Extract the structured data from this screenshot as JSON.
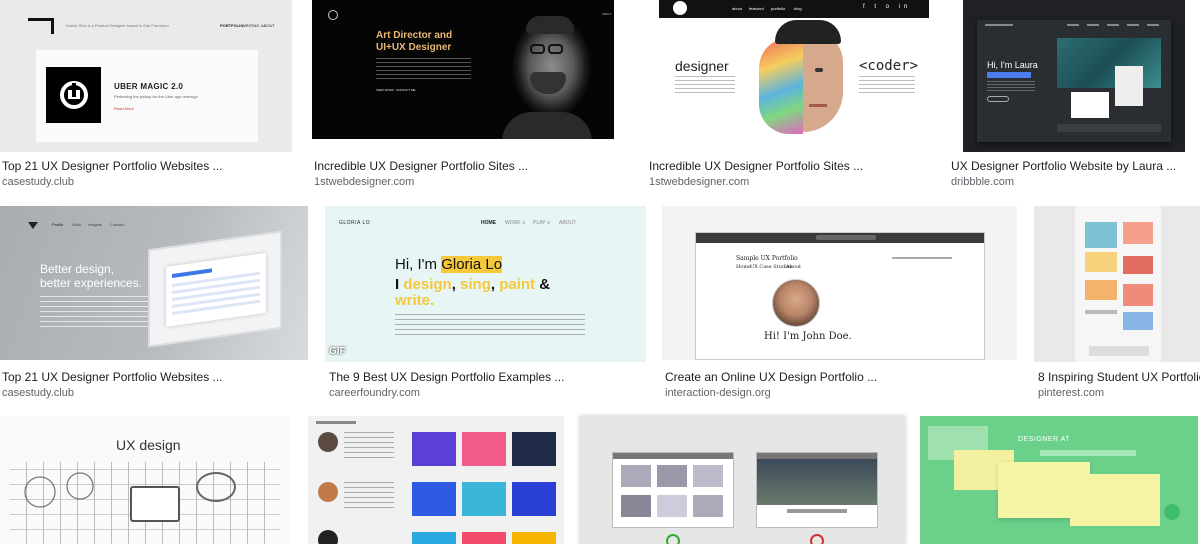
{
  "results": [
    {
      "title": "Top 21 UX Designer Portfolio Websites ...",
      "source": "casestudy.club",
      "thumb": {
        "nav": [
          "PORTFOLIO",
          "WRITING",
          "ABOUT"
        ],
        "tagline": "Karish Reis is a Product Designer based in San Francisco",
        "card_title": "UBER MAGIC 2.0",
        "card_desc": "Perfecting the pickup for the Uber app redesign",
        "card_link": "Read More"
      }
    },
    {
      "title": "Incredible UX Designer Portfolio Sites ...",
      "source": "1stwebdesigner.com",
      "thumb": {
        "heading_1": "Art Director and",
        "heading_2": "UI+UX Designer",
        "nav": [
          "HOME",
          "PORTFOLIO",
          "CONTACT"
        ],
        "cta": [
          "VIEW WORK",
          "CONTACT ME"
        ]
      }
    },
    {
      "title": "Incredible UX Designer Portfolio Sites ...",
      "source": "1stwebdesigner.com",
      "thumb": {
        "nav": [
          "about",
          "featured",
          "portfolio",
          "blog",
          "contact"
        ],
        "left_word": "designer",
        "right_word": "<coder>"
      }
    },
    {
      "title": "UX Designer Portfolio Website by Laura ...",
      "source": "dribbble.com",
      "thumb": {
        "greeting": "Hi, I'm Laura"
      }
    },
    {
      "title": "Top 21 UX Designer Portfolio Websites ...",
      "source": "casestudy.club",
      "thumb": {
        "nav": [
          "Profile",
          "Work",
          "Insights",
          "Contact"
        ],
        "headline_1": "Better design,",
        "headline_2": "better experiences."
      }
    },
    {
      "title": "The 9 Best UX Design Portfolio Examples ...",
      "source": "careerfoundry.com",
      "thumb": {
        "brand": "GLORIA LO",
        "nav": [
          "HOME",
          "WORK ∨",
          "PLAY ∨",
          "ABOUT"
        ],
        "greeting": "Hi, I'm ",
        "name": "Gloria Lo",
        "line2_prefix": "I ",
        "design": "design",
        "sing": "sing",
        "paint": "paint",
        "amp": " &",
        "write": "write.",
        "badge": "GIF"
      }
    },
    {
      "title": "Create an Online UX Design Portfolio ...",
      "source": "interaction-design.org",
      "thumb": {
        "site_title": "Sample UX Portfolio",
        "nav": [
          "Home",
          "UX Case Studies",
          "About"
        ],
        "greeting": "Hi! I'm John Doe."
      }
    },
    {
      "title": "8 Inspiring Student UX Portfolio...",
      "source": "pinterest.com",
      "thumb": {}
    },
    {
      "title": "",
      "source": "",
      "thumb": {
        "heading": "UX design"
      }
    },
    {
      "title": "",
      "source": "",
      "thumb": {}
    },
    {
      "title": "",
      "source": "",
      "thumb": {}
    },
    {
      "title": "",
      "source": "",
      "thumb": {
        "heading": "DESIGNER AT"
      }
    }
  ],
  "colors": {
    "title": "#202124",
    "source": "#5f6368"
  }
}
